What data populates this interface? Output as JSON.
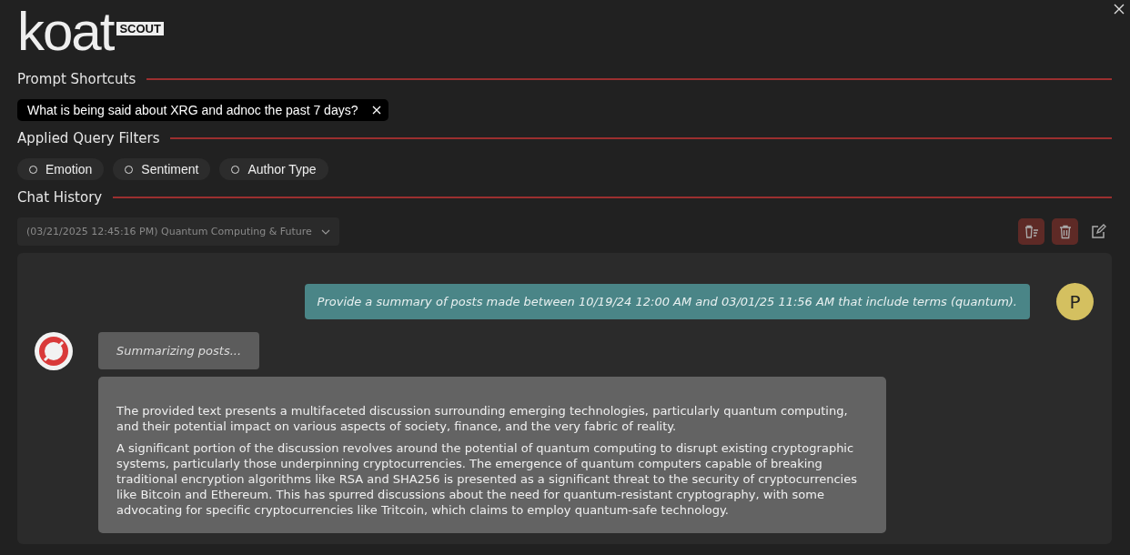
{
  "logo": {
    "wordmark": "koat",
    "badge": "SCOUT"
  },
  "sections": {
    "prompt_shortcuts": "Prompt Shortcuts",
    "filters": "Applied Query Filters",
    "history": "Chat History"
  },
  "shortcuts": [
    {
      "label": "What is being said about XRG and adnoc the past 7 days?"
    }
  ],
  "filters": [
    {
      "label": "Emotion",
      "selected": false
    },
    {
      "label": "Sentiment",
      "selected": false
    },
    {
      "label": "Author Type",
      "selected": false
    }
  ],
  "history_select": {
    "value": "(03/21/2025 12:45:16 PM) Quantum Computing & Future"
  },
  "messages": [
    {
      "kind": "user",
      "avatar": "P",
      "text": "Provide a summary of posts made between 10/19/24 12:00 AM and 03/01/25 11:56 AM that include terms (quantum)."
    },
    {
      "kind": "status",
      "text": "Summarizing posts..."
    },
    {
      "kind": "answer",
      "paragraphs": [
        "The provided text presents a multifaceted discussion surrounding emerging technologies, particularly quantum computing, and their potential impact on various aspects of society, finance, and the very fabric of reality.",
        "A significant portion of the discussion revolves around the potential of quantum computing to disrupt existing cryptographic systems, particularly those underpinning cryptocurrencies. The emergence of quantum computers capable of breaking traditional encryption algorithms like RSA and SHA256 is presented as a significant threat to the security of cryptocurrencies like Bitcoin and Ethereum. This has spurred discussions about the need for quantum-resistant cryptography, with some advocating for specific cryptocurrencies like Tritcoin, which claims to employ quantum-safe technology."
      ]
    }
  ]
}
